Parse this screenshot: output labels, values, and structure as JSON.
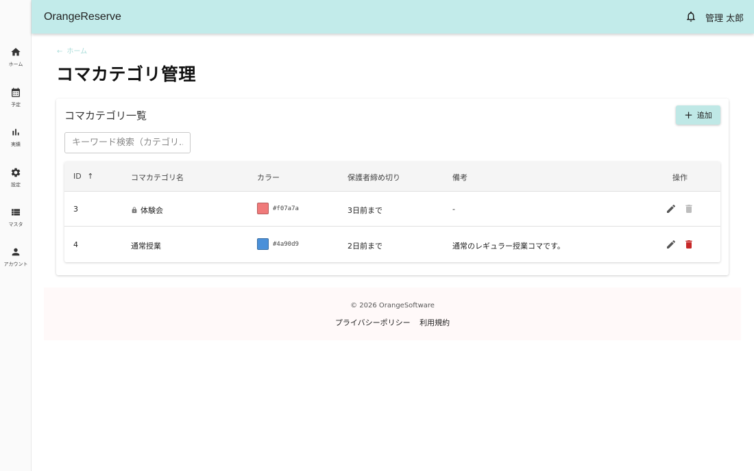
{
  "app": {
    "brand": "OrangeReserve",
    "user_name": "管理 太郎"
  },
  "sidebar": {
    "items": [
      {
        "label": "ホーム",
        "icon": "home-icon"
      },
      {
        "label": "予定",
        "icon": "calendar-icon"
      },
      {
        "label": "実績",
        "icon": "bar-chart-icon"
      },
      {
        "label": "設定",
        "icon": "gear-icon"
      },
      {
        "label": "マスタ",
        "icon": "list-icon"
      },
      {
        "label": "アカウント",
        "icon": "person-icon"
      }
    ]
  },
  "breadcrumb": {
    "arrow": "←",
    "label": "ホーム"
  },
  "page": {
    "title": "コマカテゴリ管理"
  },
  "card": {
    "title": "コマカテゴリ一覧",
    "add_label": "追加",
    "search_placeholder": "キーワード検索（カテゴリ..."
  },
  "table": {
    "headers": {
      "id": "ID",
      "sort_arrow": "↑",
      "name": "コマカテゴリ名",
      "color": "カラー",
      "deadline": "保護者締め切り",
      "note": "備考",
      "actions": "操作"
    },
    "rows": [
      {
        "id": "3",
        "name": "体験会",
        "locked": true,
        "color": "#f07a7a",
        "color_label": "#f07a7a",
        "deadline": "3日前まで",
        "note": "-",
        "delete_enabled": false
      },
      {
        "id": "4",
        "name": "通常授業",
        "locked": false,
        "color": "#4a90d9",
        "color_label": "#4a90d9",
        "deadline": "2日前まで",
        "note": "通常のレギュラー授業コマです。",
        "delete_enabled": true
      }
    ]
  },
  "footer": {
    "copyright": "© 2026 OrangeSoftware",
    "links": [
      "プライバシーポリシー",
      "利用規約"
    ]
  },
  "colors": {
    "appbar": "#c2ebea",
    "accent": "#bfe8e6",
    "delete_active": "#c62828",
    "disabled_icon": "#bdbdbd"
  }
}
